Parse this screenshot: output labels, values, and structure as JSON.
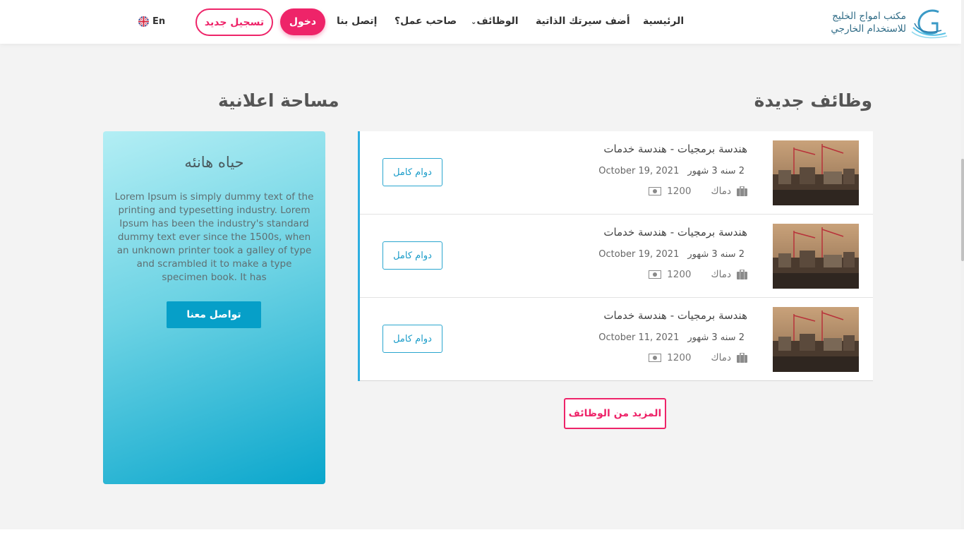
{
  "header": {
    "logo": {
      "line1": "مكتب امواج الخليج",
      "line2": "للاستخدام الخارجي"
    },
    "nav": {
      "home": "الرئيسية",
      "add_cv": "أضف سيرتك الذاتية",
      "jobs": "الوظائف",
      "employer": "صاحب عمل؟",
      "contact": "إتصل بنا"
    },
    "login": "دخول",
    "register": "تسجيل جديد",
    "language": "En"
  },
  "jobs_section": {
    "title": "وظائف جديدة",
    "items": [
      {
        "title": "هندسة برمجيات - هندسة خدمات",
        "experience": "2 سنه 3 شهور",
        "date": "October 19, 2021",
        "location": "دماك",
        "salary": "1200",
        "type": "دوام كامل"
      },
      {
        "title": "هندسة برمجيات - هندسة خدمات",
        "experience": "2 سنه 3 شهور",
        "date": "October 19, 2021",
        "location": "دماك",
        "salary": "1200",
        "type": "دوام كامل"
      },
      {
        "title": "هندسة برمجيات - هندسة خدمات",
        "experience": "2 سنه 3 شهور",
        "date": "October 11, 2021",
        "location": "دماك",
        "salary": "1200",
        "type": "دوام كامل"
      }
    ],
    "more_button": "المزيد من الوظائف"
  },
  "ad_section": {
    "title": "مساحة اعلانية",
    "card_title": "حياه هانئه",
    "card_text": "Lorem Ipsum is simply dummy text of the printing and typesetting industry. Lorem Ipsum has been the industry's standard dummy text ever since the 1500s, when an unknown printer took a galley of type and scrambled it to make a type specimen book. It has",
    "card_button": "تواصل معنا"
  },
  "colors": {
    "primary": "#ee2469",
    "accent": "#2eaee0",
    "ad_button": "#069fc8"
  },
  "icons": {
    "nav_dropdown": "chevron-down-icon",
    "language": "uk-flag-icon",
    "location": "briefcase-icon",
    "salary": "cash-icon"
  }
}
